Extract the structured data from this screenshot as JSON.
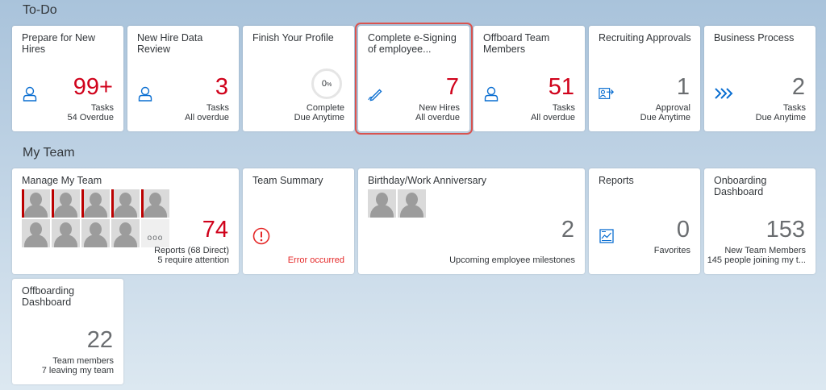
{
  "sections": {
    "todo": "To-Do",
    "team": "My Team"
  },
  "todo_tiles": [
    {
      "title": "Prepare for New Hires",
      "value": "99+",
      "unit": "Tasks",
      "footer": "54 Overdue",
      "icon": "person-icon"
    },
    {
      "title": "New Hire Data Review",
      "value": "3",
      "unit": "Tasks",
      "footer": "All overdue",
      "icon": "person-icon"
    },
    {
      "title": "Finish Your Profile",
      "value": "0",
      "value_suffix": "%",
      "unit": "Complete",
      "footer": "Due Anytime",
      "progress": 0
    },
    {
      "title": "Complete e-Signing of employee...",
      "value": "7",
      "unit": "New Hires",
      "footer": "All overdue",
      "icon": "pen-icon"
    },
    {
      "title": "Offboard Team Members",
      "value": "51",
      "unit": "Tasks",
      "footer": "All overdue",
      "icon": "person-icon"
    },
    {
      "title": "Recruiting Approvals",
      "value": "1",
      "unit": "Approval",
      "footer": "Due Anytime",
      "icon": "approval-icon"
    },
    {
      "title": "Business Process",
      "value": "2",
      "unit": "Tasks",
      "footer": "Due Anytime",
      "icon": "chevrons-icon"
    }
  ],
  "team_tiles": {
    "manage": {
      "title": "Manage My Team",
      "value": "74",
      "unit": "Reports (68 Direct)",
      "footer": "5 require attention",
      "more": "ooo"
    },
    "summary": {
      "title": "Team Summary",
      "error": "Error occurred"
    },
    "birthday": {
      "title": "Birthday/Work Anniversary",
      "value": "2",
      "footer": "Upcoming employee milestones"
    },
    "reports": {
      "title": "Reports",
      "value": "0",
      "unit": "Favorites"
    },
    "onboarding": {
      "title": "Onboarding Dashboard",
      "value": "153",
      "unit": "New Team Members",
      "footer": "145 people joining my t..."
    },
    "offboarding": {
      "title": "Offboarding Dashboard",
      "value": "22",
      "unit": "Team members",
      "footer": "7 leaving my team"
    }
  },
  "colors": {
    "accent": "#d0021b",
    "icon": "#0a6ed1",
    "error": "#e52929",
    "selection": "#d9534f"
  }
}
